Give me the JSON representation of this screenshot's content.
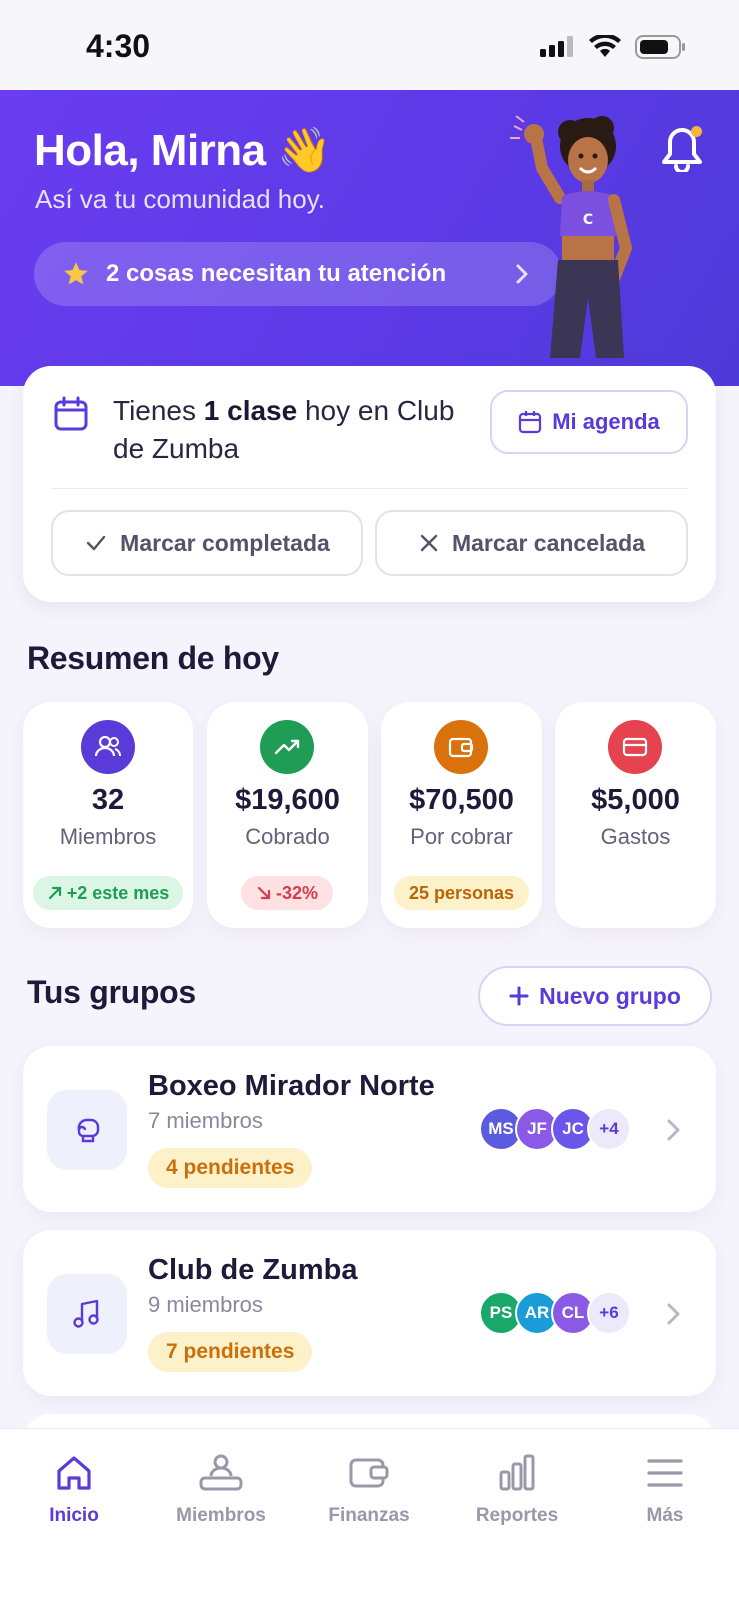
{
  "status_bar": {
    "time": "4:30"
  },
  "hero": {
    "greeting": "Hola, Mirna 👋",
    "subtitle": "Así va tu comunidad hoy.",
    "attention": "2 cosas necesitan tu atención",
    "accent": "#5b3ae6"
  },
  "class_card": {
    "text_pre": "Tienes ",
    "text_bold": "1 clase",
    "text_post": " hoy en Club de Zumba",
    "agenda_label": "Mi agenda",
    "mark_done_label": "Marcar completada",
    "mark_cancel_label": "Marcar cancelada"
  },
  "summary": {
    "title": "Resumen de hoy",
    "stats": [
      {
        "value": "32",
        "label": "Miembros",
        "badge": "+2 este mes",
        "icon": "users-icon",
        "color": "#5a3ad9"
      },
      {
        "value": "$19,600",
        "label": "Cobrado",
        "badge": "-32%",
        "icon": "trending-up-icon",
        "color": "#1f9d55"
      },
      {
        "value": "$70,500",
        "label": "Por cobrar",
        "badge": "25 personas",
        "icon": "wallet-icon",
        "color": "#d9720c"
      },
      {
        "value": "$5,000",
        "label": "Gastos",
        "badge": "",
        "icon": "card-icon",
        "color": "#e5434f"
      }
    ]
  },
  "groups": {
    "title": "Tus grupos",
    "new_label": "Nuevo grupo",
    "items": [
      {
        "name": "Boxeo Mirador Norte",
        "members": "7 miembros",
        "pending": "4 pendientes",
        "icon": "boxing-glove-icon",
        "avatars": [
          "MS",
          "JF",
          "JC"
        ],
        "more": "+4"
      },
      {
        "name": "Club de Zumba",
        "members": "9 miembros",
        "pending": "7 pendientes",
        "icon": "music-note-icon",
        "avatars": [
          "PS",
          "AR",
          "CL"
        ],
        "more": "+6"
      }
    ]
  },
  "nav": {
    "items": [
      {
        "label": "Inicio",
        "icon": "home-icon",
        "active": true
      },
      {
        "label": "Miembros",
        "icon": "members-icon"
      },
      {
        "label": "Finanzas",
        "icon": "wallet-icon"
      },
      {
        "label": "Reportes",
        "icon": "bar-chart-icon"
      },
      {
        "label": "Más",
        "icon": "menu-icon"
      }
    ]
  }
}
